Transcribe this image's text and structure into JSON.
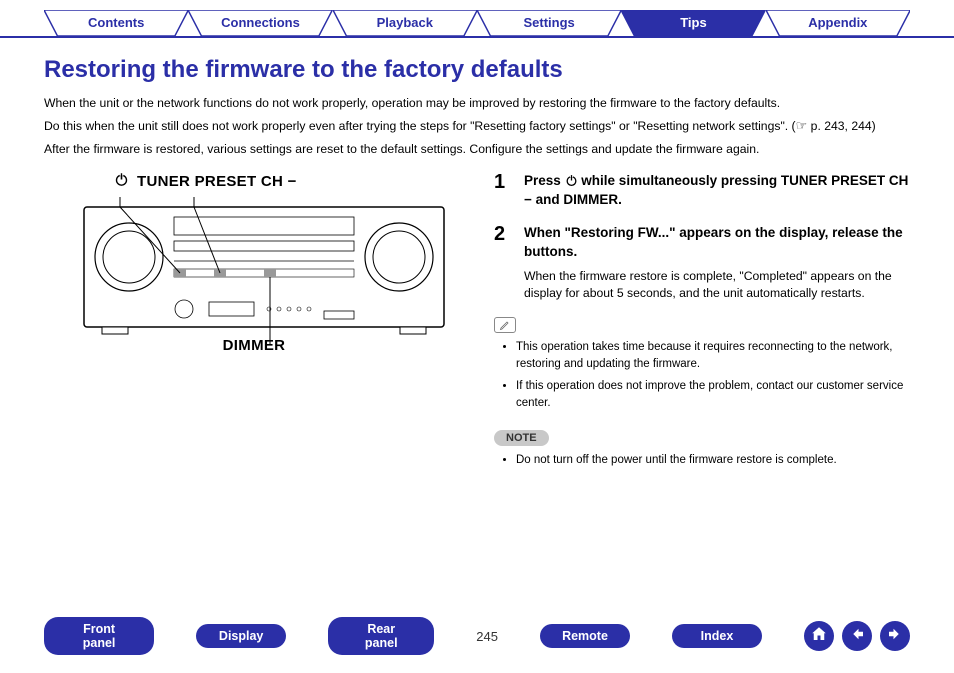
{
  "topnav": {
    "items": [
      {
        "label": "Contents",
        "active": false
      },
      {
        "label": "Connections",
        "active": false
      },
      {
        "label": "Playback",
        "active": false
      },
      {
        "label": "Settings",
        "active": false
      },
      {
        "label": "Tips",
        "active": true
      },
      {
        "label": "Appendix",
        "active": false
      }
    ]
  },
  "title": "Restoring the firmware to the factory defaults",
  "intro": {
    "p1": "When the unit or the network functions do not work properly, operation may be improved by restoring the firmware to the factory defaults.",
    "p2_a": "Do this when the unit still does not work properly even after trying the steps for \"Resetting factory settings\" or \"Resetting network settings\". (",
    "p2_b": " p. 243, 244)",
    "p3": "After the firmware is restored, various settings are reset to the default settings. Configure the settings and update the firmware again."
  },
  "diagram": {
    "label_top": "TUNER PRESET CH −",
    "label_bottom": "DIMMER"
  },
  "steps": [
    {
      "num": "1",
      "title_a": "Press ",
      "title_b": " while simultaneously pressing TUNER PRESET CH − and DIMMER."
    },
    {
      "num": "2",
      "title": "When \"Restoring FW...\" appears on the display, release the buttons.",
      "desc": "When the firmware restore is complete, \"Completed\" appears on the display for about 5 seconds, and the unit automatically restarts."
    }
  ],
  "tips": [
    "This operation takes time because it requires reconnecting to the network, restoring and updating the firmware.",
    "If this operation does not improve the problem, contact our customer service center."
  ],
  "note_badge": "NOTE",
  "notes": [
    "Do not turn off the power until the firmware restore is complete."
  ],
  "bottomnav": {
    "items": [
      {
        "label": "Front panel"
      },
      {
        "label": "Display"
      },
      {
        "label": "Rear panel"
      }
    ],
    "page": "245",
    "items2": [
      {
        "label": "Remote"
      },
      {
        "label": "Index"
      }
    ]
  }
}
